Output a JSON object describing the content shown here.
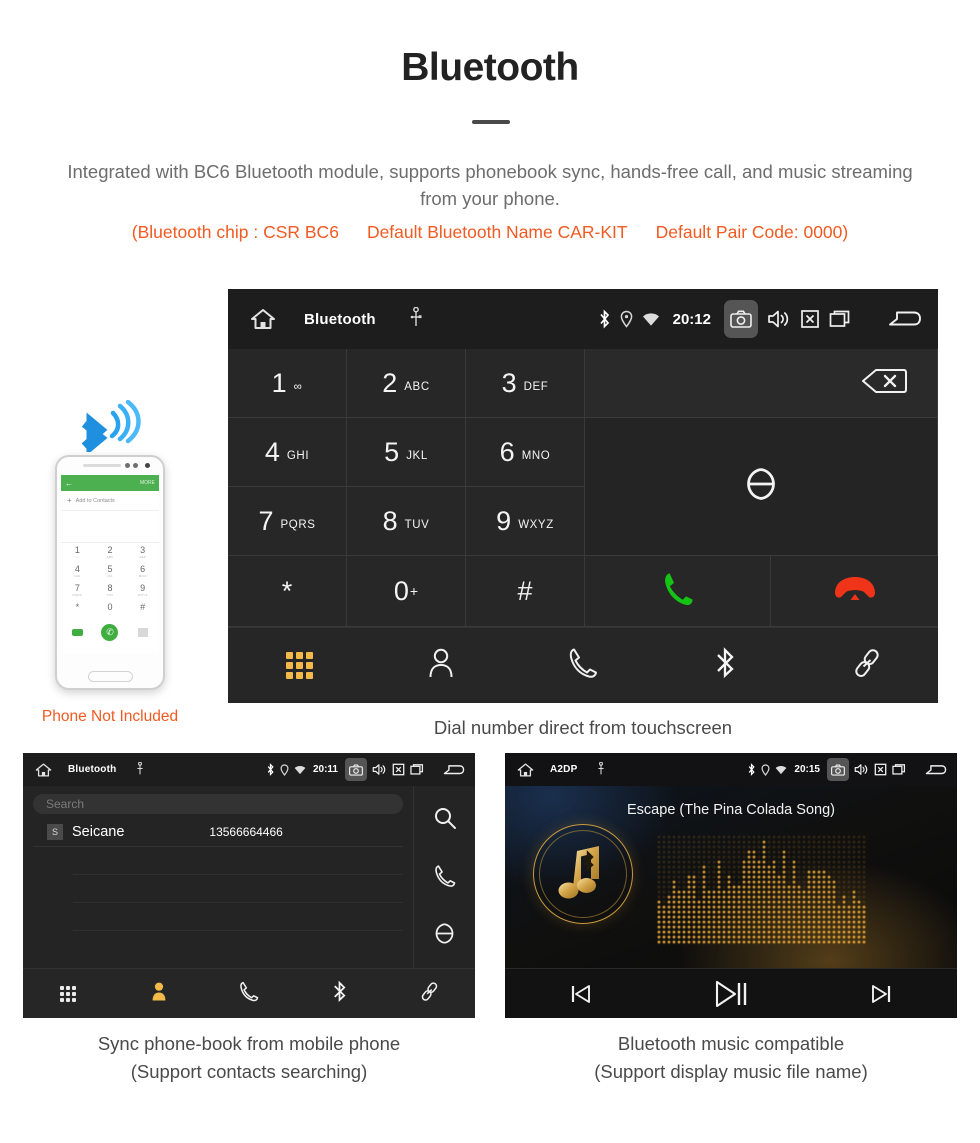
{
  "hero": {
    "title": "Bluetooth",
    "description": "Integrated with BC6 Bluetooth module, supports phonebook sync, hands-free call, and music streaming from your phone.",
    "spec_chip": "(Bluetooth chip : CSR BC6",
    "spec_name": "Default Bluetooth Name CAR-KIT",
    "spec_pair": "Default Pair Code: 0000)",
    "accent_color": "#f15a22",
    "body_color": "#6d6d6d"
  },
  "phone_mock": {
    "caption": "Phone Not Included",
    "topbar_back": "←",
    "topbar_more": "MORE",
    "add_plus": "+",
    "add_label": "Add to Contacts",
    "keys": [
      {
        "num": "1",
        "sub": "∞"
      },
      {
        "num": "2",
        "sub": "ABC"
      },
      {
        "num": "3",
        "sub": "DEF"
      },
      {
        "num": "4",
        "sub": "GHI"
      },
      {
        "num": "5",
        "sub": "JKL"
      },
      {
        "num": "6",
        "sub": "MNO"
      },
      {
        "num": "7",
        "sub": "PQRS"
      },
      {
        "num": "8",
        "sub": "TUV"
      },
      {
        "num": "9",
        "sub": "WXYZ"
      },
      {
        "num": "*",
        "sub": ""
      },
      {
        "num": "0",
        "sub": "+"
      },
      {
        "num": "#",
        "sub": ""
      }
    ]
  },
  "main_screen": {
    "statusbar": {
      "title": "Bluetooth",
      "time": "20:12",
      "icons": [
        "home-icon",
        "usb-icon",
        "bluetooth-icon",
        "location-icon",
        "wifi-icon",
        "camera-icon",
        "volume-icon",
        "close-icon",
        "recents-icon",
        "back-icon"
      ]
    },
    "keypad": [
      {
        "num": "1",
        "sub": "∞",
        "sup": ""
      },
      {
        "num": "2",
        "sub": "ABC",
        "sup": ""
      },
      {
        "num": "3",
        "sub": "DEF",
        "sup": ""
      },
      {
        "num": "4",
        "sub": "GHI",
        "sup": ""
      },
      {
        "num": "5",
        "sub": "JKL",
        "sup": ""
      },
      {
        "num": "6",
        "sub": "MNO",
        "sup": ""
      },
      {
        "num": "7",
        "sub": "PQRS",
        "sup": ""
      },
      {
        "num": "8",
        "sub": "TUV",
        "sup": ""
      },
      {
        "num": "9",
        "sub": "WXYZ",
        "sup": ""
      },
      {
        "num": "*",
        "sub": "",
        "sup": ""
      },
      {
        "num": "0",
        "sub": "",
        "sup": "+"
      },
      {
        "num": "#",
        "sub": "",
        "sup": ""
      }
    ],
    "number_display": "",
    "call_color": "#15c315",
    "hangup_color": "#f0341a",
    "tabs": [
      {
        "name": "dialpad",
        "active": true
      },
      {
        "name": "contacts",
        "active": false
      },
      {
        "name": "call-log",
        "active": false
      },
      {
        "name": "bluetooth",
        "active": false
      },
      {
        "name": "pair-link",
        "active": false
      }
    ],
    "active_tab_color": "#f3b949",
    "caption": "Dial number direct from touchscreen"
  },
  "phonebook_screen": {
    "statusbar": {
      "title": "Bluetooth",
      "time": "20:11"
    },
    "search_placeholder": "Search",
    "contacts": [
      {
        "initial": "S",
        "name": "Seicane",
        "number": "13566664466"
      }
    ],
    "side_actions": [
      "search-icon",
      "call-icon",
      "sync-icon"
    ],
    "tabs": [
      {
        "name": "dialpad",
        "active": false
      },
      {
        "name": "contacts",
        "active": true
      },
      {
        "name": "call-log",
        "active": false
      },
      {
        "name": "bluetooth",
        "active": false
      },
      {
        "name": "pair-link",
        "active": false
      }
    ],
    "caption_line1": "Sync phone-book from mobile phone",
    "caption_line2": "(Support contacts searching)"
  },
  "music_screen": {
    "statusbar": {
      "title": "A2DP",
      "time": "20:15"
    },
    "track_title": "Escape (The Pina Colada Song)",
    "controls": [
      "previous-track",
      "play-pause",
      "next-track"
    ],
    "accent_color": "#c99a3a",
    "caption_line1": "Bluetooth music compatible",
    "caption_line2": "(Support display music file name)"
  }
}
